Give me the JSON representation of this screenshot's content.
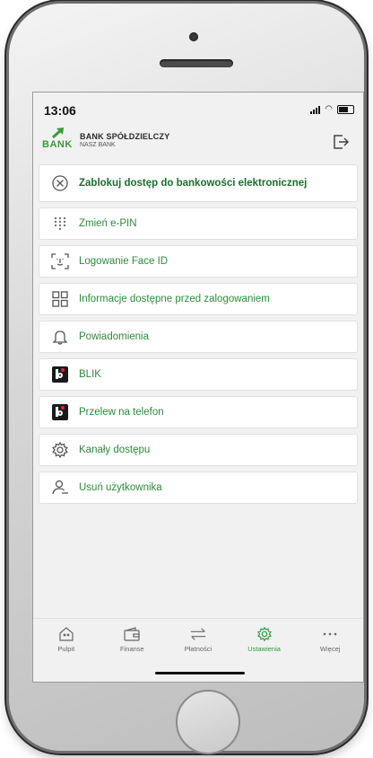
{
  "status_bar": {
    "time": "13:06"
  },
  "header": {
    "logo_text": "BANK",
    "bank_name": "BANK SPÓŁDZIELCZY",
    "bank_subtitle": "NASZ BANK",
    "brand_color": "#3a9a3a"
  },
  "menu": {
    "items": [
      {
        "label": "Zablokuj dostęp do bankowości elektronicznej",
        "icon": "block-icon"
      },
      {
        "label": "Zmień e-PIN",
        "icon": "keypad-icon"
      },
      {
        "label": "Logowanie Face ID",
        "icon": "face-id-icon"
      },
      {
        "label": "Informacje dostępne przed zalogowaniem",
        "icon": "grid-icon"
      },
      {
        "label": "Powiadomienia",
        "icon": "bell-icon"
      },
      {
        "label": "BLIK",
        "icon": "blik-icon"
      },
      {
        "label": "Przelew na telefon",
        "icon": "blik-icon"
      },
      {
        "label": "Kanały dostępu",
        "icon": "gear-icon"
      },
      {
        "label": "Usuń użytkownika",
        "icon": "remove-user-icon"
      }
    ]
  },
  "bottom_nav": {
    "items": [
      {
        "label": "Pulpit",
        "icon": "home-icon"
      },
      {
        "label": "Finanse",
        "icon": "wallet-icon"
      },
      {
        "label": "Płatności",
        "icon": "transfer-icon"
      },
      {
        "label": "Ustawienia",
        "icon": "gear-icon",
        "active": true
      },
      {
        "label": "Więcej",
        "icon": "more-icon"
      }
    ],
    "active_color": "#2e9a3e"
  }
}
